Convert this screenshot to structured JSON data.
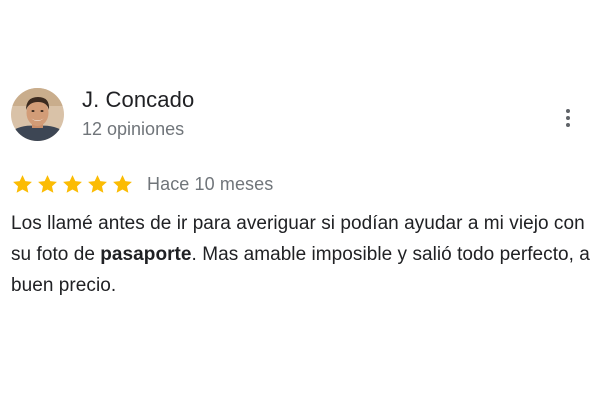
{
  "reviewer": {
    "name": "J. Concado",
    "review_count": "12 opiniones",
    "avatar_icon": "user-photo-avatar"
  },
  "menu": {
    "icon": "more-vertical-icon"
  },
  "rating": {
    "value": 5,
    "max": 5,
    "star_color": "#fbbc04",
    "date": "Hace 10 meses"
  },
  "review": {
    "text_before": "Los llamé antes de ir para averiguar si podían ayudar a mi viejo con su foto de ",
    "highlight": "pasaporte",
    "text_after": ". Mas amable imposible y salió todo perfecto, a buen precio."
  }
}
